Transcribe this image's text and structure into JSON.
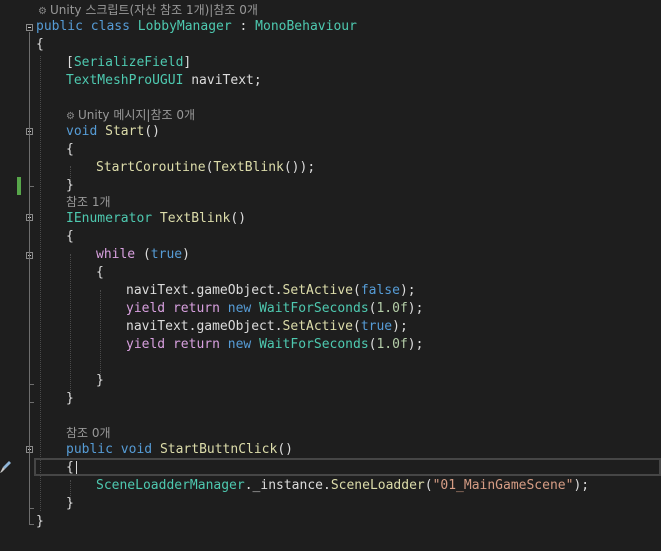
{
  "codelens": {
    "class_refs": "Unity 스크립트(자산 참조 1개)|참조 0개",
    "start_refs": "Unity 메시지|참조 0개",
    "textblink_refs": "참조 1개",
    "startbtn_refs": "참조 0개",
    "unity_icon": "unity-gear-icon"
  },
  "code": {
    "l_public": "public",
    "l_class": "class",
    "l_classname": "LobbyManager",
    "l_colon": " : ",
    "l_base": "MonoBehaviour",
    "l_open1": "{",
    "l_attr_open": "[",
    "l_attr": "SerializeField",
    "l_attr_close": "]",
    "l_field_type": "TextMeshProUGUI",
    "l_field_name": " naviText;",
    "l_void": "void",
    "l_start": "Start",
    "l_parens": "()",
    "l_open2": "{",
    "l_startco": "StartCoroutine",
    "l_startco_arg": "(",
    "l_textblink_call": "TextBlink",
    "l_startco_end": "());",
    "l_close2": "}",
    "l_ienum": "IEnumerator",
    "l_textblink": "TextBlink",
    "l_tb_parens": "()",
    "l_open3": "{",
    "l_while": "while",
    "l_while_open": " (",
    "l_true1": "true",
    "l_while_close": ")",
    "l_open4": "{",
    "l_navi1": "naviText.gameObject.",
    "l_setactive1": "SetActive",
    "l_p1o": "(",
    "l_false": "false",
    "l_p1c": ");",
    "l_yield1": "yield",
    "l_return1": "return",
    "l_new1": "new",
    "l_wfs1": "WaitForSeconds",
    "l_wfs1_o": "(",
    "l_num1": "1.0f",
    "l_wfs1_c": ");",
    "l_navi2": "naviText.gameObject.",
    "l_setactive2": "SetActive",
    "l_p2o": "(",
    "l_true2": "true",
    "l_p2c": ");",
    "l_yield2": "yield",
    "l_return2": "return",
    "l_new2": "new",
    "l_wfs2": "WaitForSeconds",
    "l_wfs2_o": "(",
    "l_num2": "1.0f",
    "l_wfs2_c": ");",
    "l_close4": "}",
    "l_close3": "}",
    "l_public2": "public",
    "l_void2": "void",
    "l_startbtn": "StartButtnClick",
    "l_sb_parens": "()",
    "l_open5": "{",
    "l_slm": "SceneLoadderManager",
    "l_instance": "._instance.",
    "l_sceneloadder": "SceneLoadder",
    "l_sl_o": "(",
    "l_scene_str": "\"01_MainGameScene\"",
    "l_sl_c": ");",
    "l_close5": "}",
    "l_close1": "}"
  },
  "colors": {
    "background": "#1e1e1e",
    "keyword": "#569cd6",
    "control_keyword": "#d8a0df",
    "type": "#4ec9b0",
    "method": "#dcdcaa",
    "string": "#d69d85",
    "number": "#b5cea8",
    "change_bar": "#57a64a"
  }
}
